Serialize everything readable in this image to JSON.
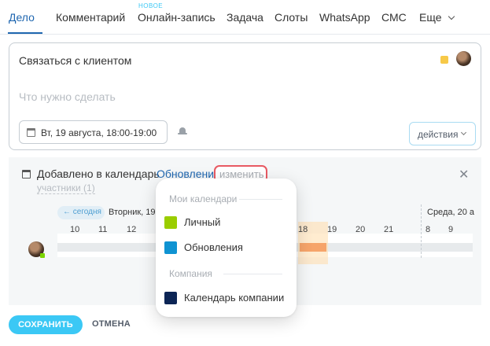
{
  "tabs": {
    "items": [
      {
        "label": "Дело"
      },
      {
        "label": "Комментарий"
      },
      {
        "label": "Онлайн-запись",
        "badge": "НОВОЕ"
      },
      {
        "label": "Задача"
      },
      {
        "label": "Слоты"
      },
      {
        "label": "WhatsApp"
      },
      {
        "label": "СМС"
      },
      {
        "label": "Еще"
      }
    ],
    "active": "Дело"
  },
  "task": {
    "title": "Связаться с клиентом",
    "placeholder": "Что нужно сделать",
    "date": "Вт, 19 августа, 18:00-19:00",
    "actions_label": "действия",
    "color": "#f7c948"
  },
  "calendar": {
    "added_label": "Добавлено в календарь",
    "calendar_name": "Обновления",
    "change_label": "изменить",
    "participants": "участники (1)",
    "today_label": "← сегодня",
    "day1": "Вторник, 19",
    "day2": "Среда, 20 а",
    "hours": [
      "10",
      "11",
      "12",
      "18",
      "19",
      "20",
      "21",
      "8",
      "9"
    ],
    "busy_color": "#f6a46a"
  },
  "popup": {
    "section1": "Мои календари",
    "section2": "Компания",
    "items": [
      {
        "label": "Личный",
        "color": "#9acd00"
      },
      {
        "label": "Обновления",
        "color": "#0f93d2"
      },
      {
        "label": "Календарь компании",
        "color": "#0c2555"
      }
    ]
  },
  "footer": {
    "save_label": "СОХРАНИТЬ",
    "cancel_label": "ОТМЕНА"
  }
}
